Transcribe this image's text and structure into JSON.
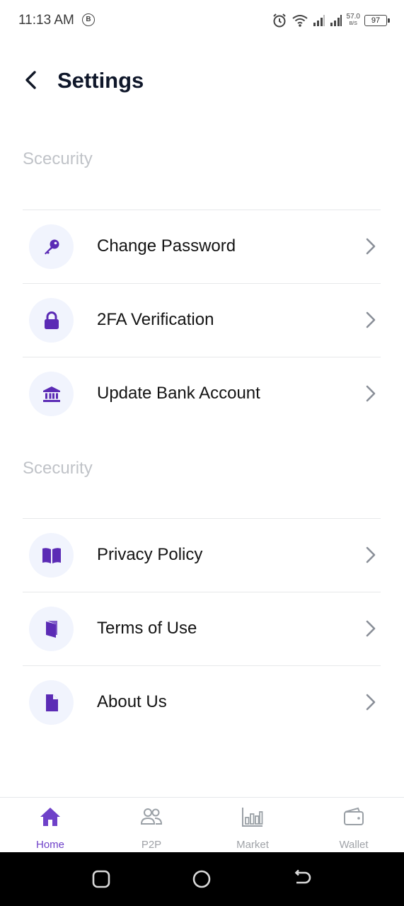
{
  "status_bar": {
    "time": "11:13 AM",
    "notification_badge": "B",
    "net_speed": "57.0",
    "net_speed_unit": "B/S",
    "battery": "97"
  },
  "header": {
    "title": "Settings",
    "back_icon": "chevron-left-icon"
  },
  "sections": [
    {
      "label": "Scecurity",
      "items": [
        {
          "label": "Change Password",
          "icon": "key-icon"
        },
        {
          "label": "2FA Verification",
          "icon": "lock-icon"
        },
        {
          "label": "Update Bank Account",
          "icon": "bank-icon"
        }
      ]
    },
    {
      "label": "Scecurity",
      "items": [
        {
          "label": "Privacy Policy",
          "icon": "open-book-icon"
        },
        {
          "label": "Terms of Use",
          "icon": "book-icon"
        },
        {
          "label": "About Us",
          "icon": "file-icon"
        }
      ]
    }
  ],
  "bottom_nav": [
    {
      "label": "Home",
      "icon": "home-icon",
      "active": true
    },
    {
      "label": "P2P",
      "icon": "users-icon",
      "active": false
    },
    {
      "label": "Market",
      "icon": "bar-chart-icon",
      "active": false
    },
    {
      "label": "Wallet",
      "icon": "wallet-icon",
      "active": false
    }
  ],
  "colors": {
    "accent": "#5b2bb5",
    "icon_bg": "#f1f4fd",
    "section_label": "#c0c3c8",
    "nav_inactive": "#a0a3a8"
  }
}
